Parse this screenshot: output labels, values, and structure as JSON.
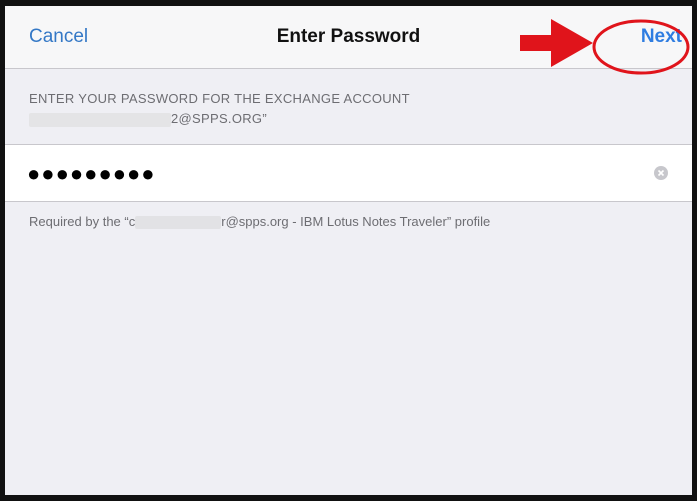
{
  "navbar": {
    "cancel_label": "Cancel",
    "title": "Enter Password",
    "next_label": "Next"
  },
  "prompt": {
    "line1": "ENTER YOUR PASSWORD FOR THE EXCHANGE ACCOUNT",
    "line2_visible": "2@SPPS.ORG”"
  },
  "password_field": {
    "masked_value": "●●●●●●●●●"
  },
  "note": {
    "prefix": "Required by the “c",
    "suffix": "r@spps.org - IBM Lotus Notes Traveler” profile"
  },
  "colors": {
    "accent": "#2f7de1",
    "annotation_red": "#e0141b",
    "background": "#efeff4"
  },
  "icons": {
    "clear": "clear-icon",
    "arrow": "red-arrow-annotation"
  }
}
